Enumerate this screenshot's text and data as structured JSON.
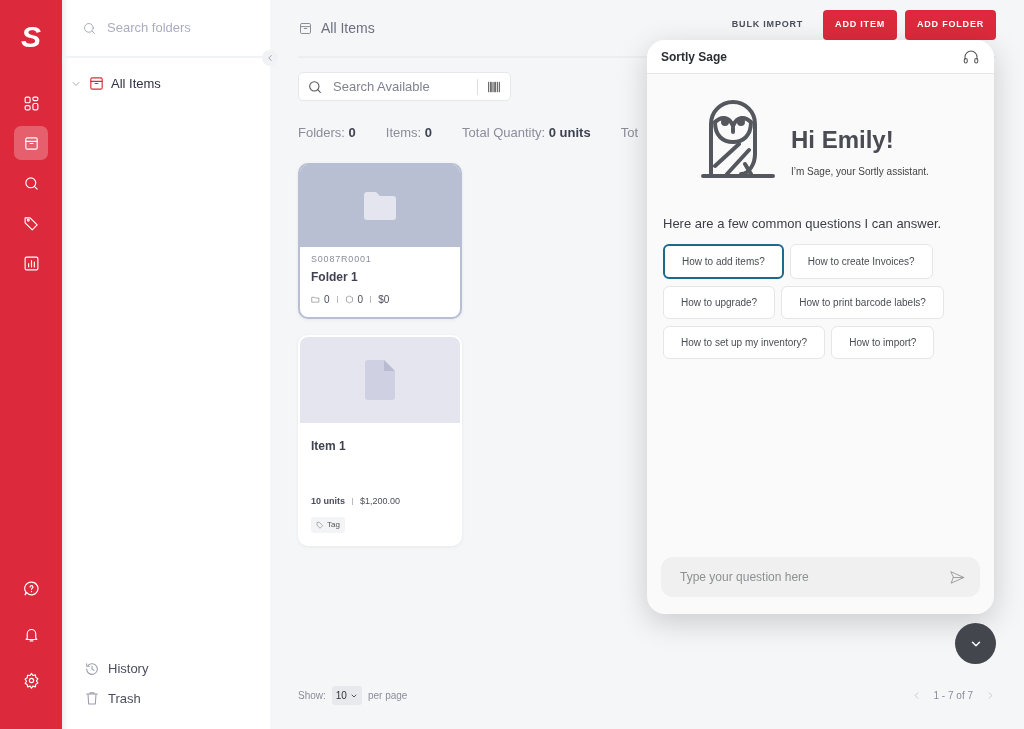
{
  "rail": {
    "logo": "S",
    "items": [
      {
        "kind": "dashboard",
        "selected": false
      },
      {
        "kind": "items",
        "selected": true
      },
      {
        "kind": "search",
        "selected": false
      },
      {
        "kind": "tags",
        "selected": false
      },
      {
        "kind": "reports",
        "selected": false
      }
    ],
    "bottom_items": [
      {
        "kind": "help"
      },
      {
        "kind": "notifications"
      },
      {
        "kind": "settings"
      }
    ]
  },
  "folder_panel": {
    "search": {
      "placeholder": "Search folders"
    },
    "tree": [
      {
        "label": "All Items",
        "expanded": true,
        "selected": true
      }
    ],
    "links": [
      {
        "kind": "history",
        "label": "History"
      },
      {
        "kind": "trash",
        "label": "Trash"
      }
    ]
  },
  "main": {
    "breadcrumb": "All Items",
    "actions": [
      {
        "kind": "link",
        "label": "BULK IMPORT"
      },
      {
        "kind": "primary",
        "label": "ADD ITEM"
      },
      {
        "kind": "primary",
        "label": "ADD FOLDER"
      }
    ],
    "search": {
      "placeholder": "Search Available"
    },
    "stats": [
      {
        "label": "Folders:",
        "value": "0"
      },
      {
        "label": "Items:",
        "value": "0"
      },
      {
        "label": "Total Quantity:",
        "value": "0 units"
      },
      {
        "label": "Tot"
      }
    ],
    "cards": [
      {
        "kind": "folder",
        "code": "S0087R0001",
        "name": "Folder 1",
        "folders": "0",
        "items": "0",
        "value": "$0",
        "selected": true
      },
      {
        "kind": "item",
        "name": "Item 1",
        "quantity": "10 units",
        "value": "$1,200.00",
        "tags": [
          "Tag"
        ],
        "selected": false
      }
    ],
    "footer": {
      "show_label": "Show:",
      "page_size": "10",
      "per_page": "per page",
      "range": "1 - 7 of 7"
    }
  },
  "chat": {
    "title": "Sortly Sage",
    "greeting": "Hi Emily!",
    "intro": "I’m Sage, your Sortly assistant.",
    "prompt": "Here are a few common questions I can answer.",
    "questions": [
      {
        "label": "How to add items?",
        "selected": true
      },
      {
        "label": "How to create Invoices?",
        "selected": false
      },
      {
        "label": "How to upgrade?",
        "selected": false
      },
      {
        "label": "How to print barcode labels?",
        "selected": false
      },
      {
        "label": "How to set up my inventory?",
        "selected": false
      },
      {
        "label": "How to import?",
        "selected": false
      }
    ],
    "input": {
      "placeholder": "Type your question here"
    }
  }
}
